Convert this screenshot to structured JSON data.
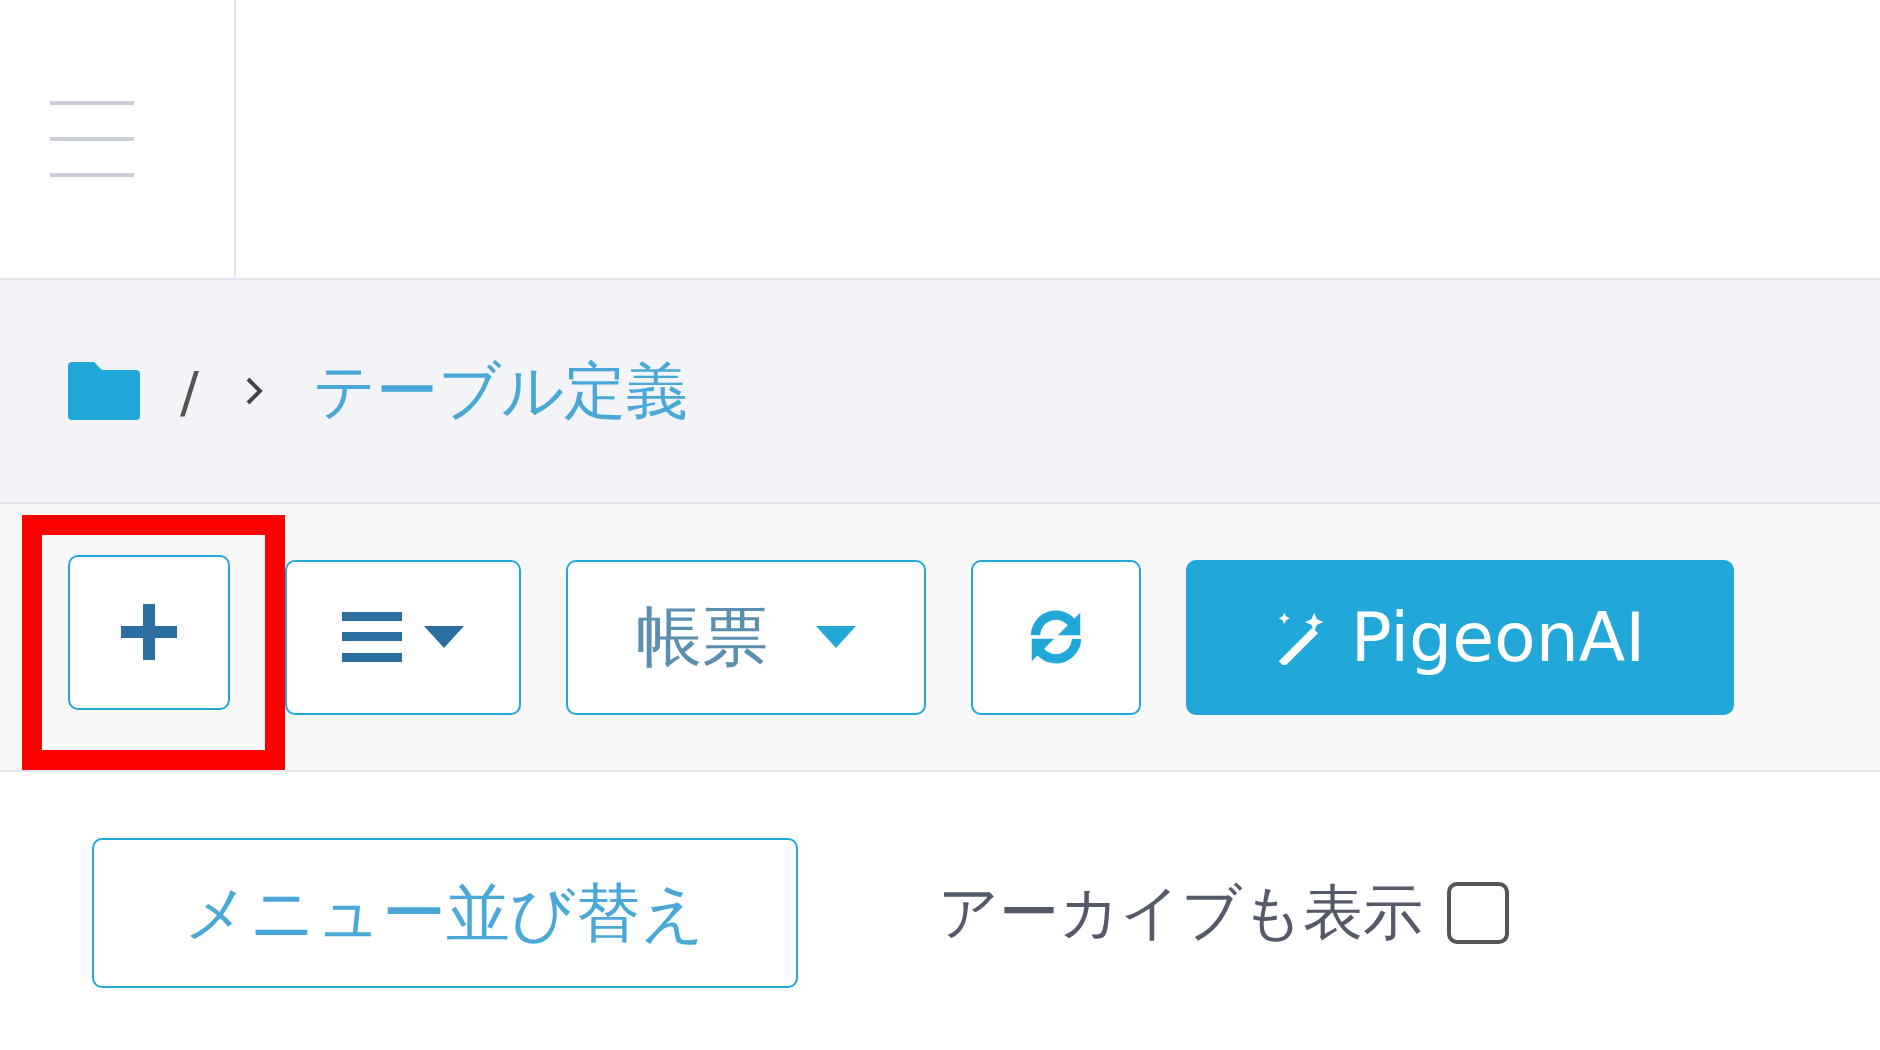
{
  "breadcrumb": {
    "separator": "/",
    "current": "テーブル定義"
  },
  "toolbar": [
    {
      "kind": "add",
      "highlighted": true
    },
    {
      "kind": "list-menu",
      "highlighted": false
    },
    {
      "kind": "dropdown",
      "label": "帳票",
      "highlighted": false
    },
    {
      "kind": "refresh",
      "highlighted": false
    },
    {
      "kind": "ai",
      "label": "PigeonAI",
      "highlighted": false
    }
  ],
  "sort_button": "メニュー並び替え",
  "archive_toggle": {
    "label": "アーカイブも表示",
    "checked": false
  }
}
